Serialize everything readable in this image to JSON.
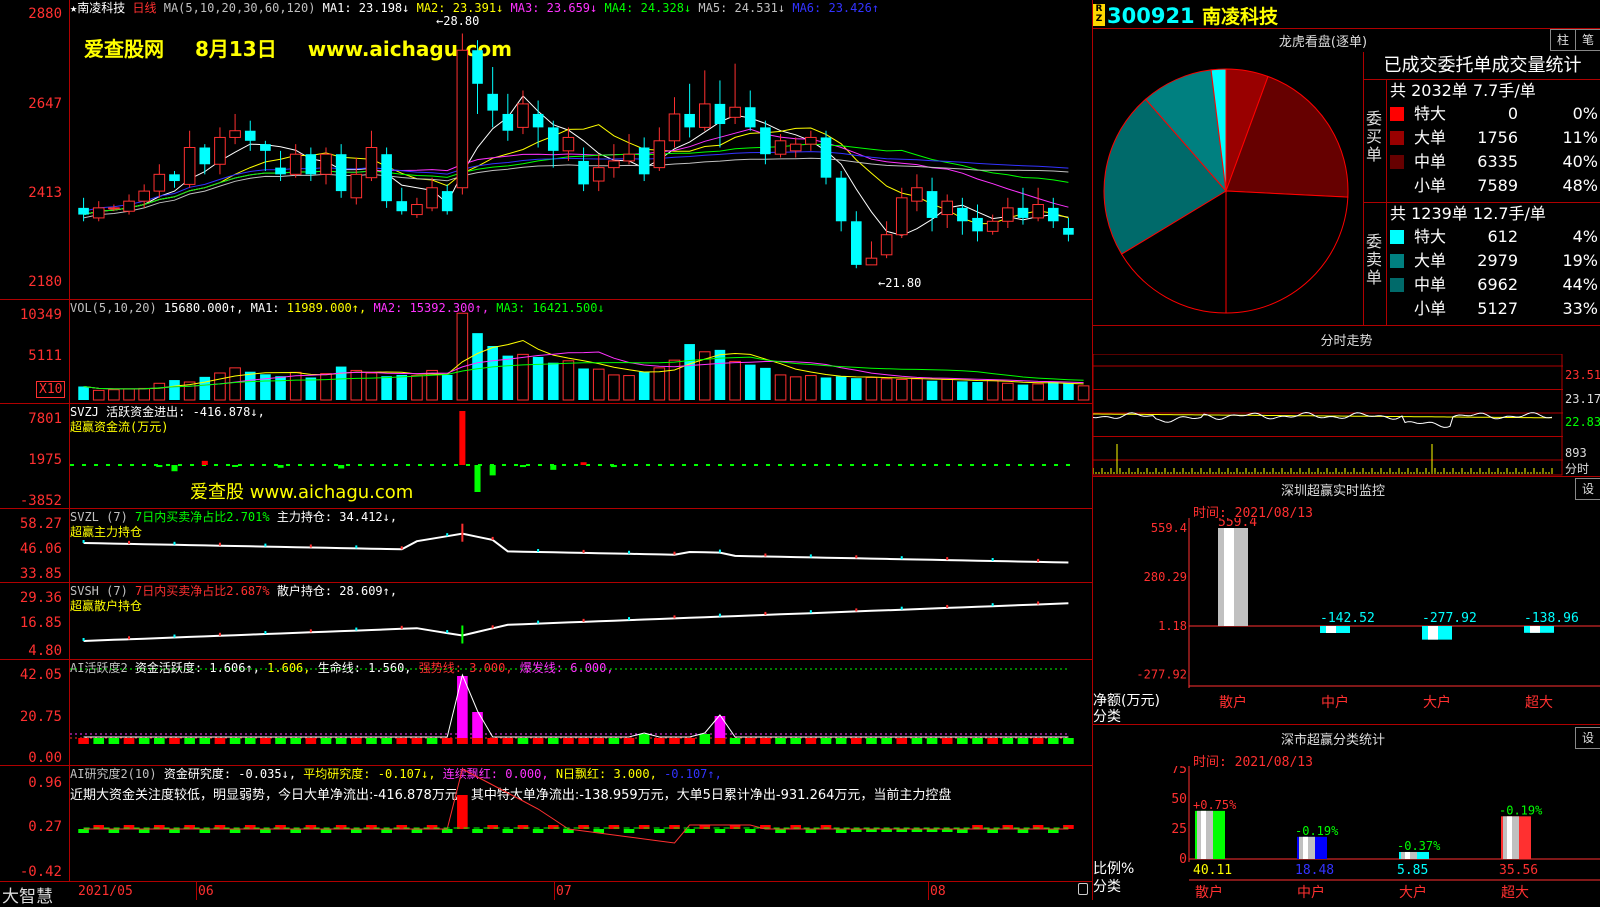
{
  "stock": {
    "code": "300921",
    "name": "南凌科技",
    "name_star": "★南凌科技",
    "period": "日线",
    "rz": "R\nZ"
  },
  "watermark": {
    "site_big": "爱查股网",
    "date": "8月13日",
    "url_big": "www.aichagu.com",
    "site_small": "爱查股",
    "url_small": "www.aichagu.com"
  },
  "main_chart": {
    "ma_params": "MA(5,10,20,30,60,120)",
    "ma_values": [
      {
        "label": "MA1:",
        "value": "23.198↓",
        "color": "#ffffff"
      },
      {
        "label": "MA2:",
        "value": "23.391↓",
        "color": "#ffff00"
      },
      {
        "label": "MA3:",
        "value": "23.659↓",
        "color": "#ff33ff"
      },
      {
        "label": "MA4:",
        "value": "24.328↓",
        "color": "#00ff00"
      },
      {
        "label": "MA5:",
        "value": "24.531↓",
        "color": "#c0c0c0"
      },
      {
        "label": "MA6:",
        "value": "23.426↑",
        "color": "#3333ff"
      }
    ],
    "y_ticks": [
      "2880",
      "2647",
      "2413",
      "2180"
    ],
    "high_label": "←28.80",
    "low_label": "←21.80",
    "candles": [
      [
        23.6,
        23.4,
        23.9,
        23.2
      ],
      [
        23.3,
        23.6,
        23.8,
        23.2
      ],
      [
        23.6,
        23.6,
        23.7,
        23.5
      ],
      [
        23.5,
        23.8,
        24.0,
        23.4
      ],
      [
        23.8,
        24.1,
        24.3,
        23.6
      ],
      [
        24.1,
        24.6,
        24.9,
        23.9
      ],
      [
        24.6,
        24.4,
        24.7,
        24.2
      ],
      [
        24.3,
        25.4,
        25.9,
        24.2
      ],
      [
        25.4,
        24.9,
        25.5,
        24.6
      ],
      [
        24.9,
        25.7,
        26.0,
        24.6
      ],
      [
        25.7,
        25.9,
        26.4,
        25.5
      ],
      [
        25.9,
        25.6,
        26.2,
        25.3
      ],
      [
        25.5,
        25.3,
        25.6,
        24.7
      ],
      [
        24.8,
        24.6,
        25.3,
        24.4
      ],
      [
        24.6,
        25.2,
        25.5,
        24.5
      ],
      [
        25.2,
        24.6,
        25.4,
        24.4
      ],
      [
        24.6,
        25.2,
        25.4,
        24.3
      ],
      [
        25.2,
        24.1,
        25.5,
        23.9
      ],
      [
        23.9,
        24.6,
        25.1,
        23.7
      ],
      [
        24.5,
        25.4,
        25.9,
        24.4
      ],
      [
        25.2,
        23.8,
        25.4,
        23.6
      ],
      [
        23.8,
        23.5,
        24.2,
        23.4
      ],
      [
        23.4,
        23.7,
        23.9,
        23.3
      ],
      [
        23.6,
        24.2,
        24.5,
        23.5
      ],
      [
        24.1,
        23.5,
        24.3,
        23.4
      ],
      [
        24.2,
        28.3,
        28.8,
        24.0
      ],
      [
        28.3,
        27.3,
        28.6,
        26.4
      ],
      [
        27.0,
        26.5,
        27.8,
        26.0
      ],
      [
        26.4,
        25.9,
        27.0,
        25.6
      ],
      [
        26.0,
        26.7,
        27.1,
        25.8
      ],
      [
        26.4,
        26.0,
        26.8,
        25.4
      ],
      [
        26.0,
        25.3,
        26.2,
        24.8
      ],
      [
        25.3,
        25.7,
        26.0,
        25.0
      ],
      [
        25.0,
        24.3,
        25.4,
        24.1
      ],
      [
        24.4,
        24.8,
        25.2,
        24.1
      ],
      [
        24.8,
        25.0,
        25.5,
        24.5
      ],
      [
        25.0,
        25.2,
        25.8,
        24.9
      ],
      [
        25.4,
        24.6,
        25.7,
        24.4
      ],
      [
        24.8,
        25.6,
        26.0,
        24.7
      ],
      [
        25.6,
        26.4,
        26.9,
        25.4
      ],
      [
        26.4,
        26.0,
        27.3,
        25.7
      ],
      [
        26.0,
        26.7,
        27.7,
        25.9
      ],
      [
        26.7,
        26.1,
        27.4,
        25.4
      ],
      [
        26.3,
        26.6,
        27.9,
        26.1
      ],
      [
        26.6,
        26.0,
        27.1,
        25.9
      ],
      [
        26.0,
        25.2,
        26.2,
        24.9
      ],
      [
        25.2,
        25.6,
        25.8,
        25.1
      ],
      [
        25.3,
        25.5,
        25.7,
        25.1
      ],
      [
        25.5,
        25.7,
        25.9,
        25.3
      ],
      [
        25.7,
        24.5,
        25.9,
        24.3
      ],
      [
        24.5,
        23.2,
        24.7,
        22.9
      ],
      [
        23.2,
        21.9,
        23.5,
        21.8
      ],
      [
        21.9,
        22.1,
        22.6,
        21.9
      ],
      [
        22.2,
        22.8,
        23.2,
        22.1
      ],
      [
        22.8,
        23.9,
        24.2,
        22.7
      ],
      [
        23.8,
        24.2,
        24.6,
        23.5
      ],
      [
        24.1,
        23.3,
        24.5,
        22.9
      ],
      [
        23.4,
        23.8,
        24.0,
        23.0
      ],
      [
        23.6,
        23.2,
        23.9,
        22.8
      ],
      [
        23.3,
        22.9,
        23.7,
        22.6
      ],
      [
        22.9,
        23.2,
        23.4,
        22.8
      ],
      [
        23.2,
        23.6,
        23.9,
        23.0
      ],
      [
        23.6,
        23.3,
        24.2,
        23.1
      ],
      [
        23.3,
        23.7,
        24.2,
        23.2
      ],
      [
        23.6,
        23.2,
        23.9,
        23.0
      ],
      [
        23.0,
        22.8,
        23.3,
        22.6
      ]
    ]
  },
  "volume": {
    "header": [
      {
        "text": "VOL(5,10,20)",
        "color": "#c0c0c0"
      },
      {
        "text": "15680.000↑,",
        "color": "#ffffff"
      },
      {
        "text": "MA1:",
        "color": "#ffffff"
      },
      {
        "text": "11989.000↑,",
        "color": "#ffff00"
      },
      {
        "text": "MA2:",
        "color": "#ff33ff"
      },
      {
        "text": "15392.300↑,",
        "color": "#ff33ff"
      },
      {
        "text": "MA3:",
        "color": "#00ff00"
      },
      {
        "text": "16421.500↓",
        "color": "#00ff00"
      }
    ],
    "y_ticks": [
      "10349",
      "5111"
    ],
    "unit": "X10",
    "values": [
      2.1,
      1.5,
      1.6,
      1.7,
      1.8,
      2.6,
      3.1,
      2.8,
      3.6,
      4.2,
      5.0,
      4.4,
      4.0,
      3.7,
      4.3,
      3.5,
      4.1,
      5.2,
      4.6,
      4.2,
      3.7,
      3.9,
      3.8,
      4.6,
      3.9,
      13.5,
      10.4,
      8.4,
      6.9,
      7.1,
      6.7,
      5.8,
      6.1,
      4.9,
      4.8,
      3.9,
      3.8,
      4.4,
      5.0,
      6.2,
      8.7,
      7.5,
      7.8,
      6.0,
      5.5,
      5.0,
      3.9,
      3.6,
      3.8,
      3.5,
      3.7,
      3.4,
      3.5,
      3.3,
      3.2,
      3.3,
      3.0,
      3.2,
      2.9,
      2.8,
      3.1,
      2.6,
      2.4,
      2.5,
      2.8,
      2.6,
      2.2
    ]
  },
  "svzj": {
    "header": [
      {
        "text": "SVZJ  活跃资金进出: -416.878↓,",
        "color": "#ffffff"
      }
    ],
    "subtitle": "超赢资金流(万元)",
    "y_ticks": [
      "7801",
      "1975",
      "-3852"
    ],
    "values": [
      0,
      0,
      0,
      0,
      0,
      -300,
      -900,
      0,
      600,
      0,
      -200,
      0,
      0,
      -400,
      0,
      0,
      0,
      -500,
      0,
      0,
      0,
      0,
      0,
      0,
      0,
      7800,
      -3900,
      -1500,
      0,
      -300,
      0,
      -700,
      0,
      400,
      0,
      -300,
      0,
      0,
      0,
      0,
      0,
      0,
      0,
      0,
      0,
      0,
      0,
      0,
      0,
      0,
      0,
      0,
      0,
      0,
      0,
      0,
      0,
      0,
      0,
      0,
      0,
      0,
      0,
      0,
      0,
      0,
      0
    ]
  },
  "svzl": {
    "header": [
      {
        "text": "SVZL (7)",
        "color": "#c0c0c0"
      },
      {
        "text": "7日内买卖净占比2.701%",
        "color": "#00ff00"
      },
      {
        "text": "主力持仓: 34.412↓,",
        "color": "#ffffff"
      }
    ],
    "subtitle": "超赢主力持仓",
    "y_ticks": [
      "58.27",
      "46.06",
      "33.85"
    ]
  },
  "svsh": {
    "header": [
      {
        "text": "SVSH (7)",
        "color": "#c0c0c0"
      },
      {
        "text": "7日内买卖净占比2.687%",
        "color": "#ff3030"
      },
      {
        "text": "散户持仓: 28.609↑,",
        "color": "#ffffff"
      }
    ],
    "subtitle": "超赢散户持仓",
    "y_ticks": [
      "29.36",
      "16.85",
      "4.80"
    ]
  },
  "ai_active": {
    "header": [
      {
        "text": "AI活跃度2",
        "color": "#c0c0c0"
      },
      {
        "text": "资金活跃度: 1.606↑,",
        "color": "#ffffff"
      },
      {
        "text": "1.606,",
        "color": "#ffff00"
      },
      {
        "text": "生命线: 1.560,",
        "color": "#ffffff"
      },
      {
        "text": "强势线: 3.000,",
        "color": "#ff3030"
      },
      {
        "text": "爆发线: 6.000,",
        "color": "#ff33ff"
      }
    ],
    "y_ticks": [
      "42.05",
      "20.75",
      "0.00"
    ]
  },
  "ai_research": {
    "header": [
      {
        "text": "AI研究度2(10)",
        "color": "#c0c0c0"
      },
      {
        "text": "资金研究度: -0.035↓,",
        "color": "#ffffff"
      },
      {
        "text": "平均研究度: -0.107↓,",
        "color": "#ffff00"
      },
      {
        "text": "连续飘红: 0.000,",
        "color": "#ff33ff"
      },
      {
        "text": "N日飘红: 3.000,",
        "color": "#ffff00"
      },
      {
        "text": "-0.107↑,",
        "color": "#3333ff"
      }
    ],
    "comment": "近期大资金关注度较低，明显弱势，今日大单净流出:-416.878万元，其中特大单净流出:-138.959万元，大单5日累计净出-931.264万元，当前主力控盘",
    "y_ticks": [
      "0.96",
      "0.27",
      "-0.42"
    ]
  },
  "x_axis": {
    "labels": [
      "2021/05",
      "06",
      "07",
      "08"
    ],
    "brand": "大智慧"
  },
  "lhb": {
    "title": "龙虎看盘(逐单)",
    "btn_bar": "柱",
    "btn_pen": "笔",
    "table_title": "已成交委托单成交量统计",
    "buy_label": "委买单",
    "sell_label": "委卖单",
    "buy_total": "共 2032单 7.7手/单",
    "sell_total": "共 1239单 12.7手/单",
    "buy_rows": [
      {
        "name": "特大",
        "count": "0",
        "pct": "0%",
        "color": "#ff0000"
      },
      {
        "name": "大单",
        "count": "1756",
        "pct": "11%",
        "color": "#990000"
      },
      {
        "name": "中单",
        "count": "6335",
        "pct": "40%",
        "color": "#660000"
      },
      {
        "name": "小单",
        "count": "7589",
        "pct": "48%",
        "color": "#000000"
      }
    ],
    "sell_rows": [
      {
        "name": "特大",
        "count": "612",
        "pct": "4%",
        "color": "#00ffff"
      },
      {
        "name": "大单",
        "count": "2979",
        "pct": "19%",
        "color": "#008080"
      },
      {
        "name": "中单",
        "count": "6962",
        "pct": "44%",
        "color": "#006a6a"
      },
      {
        "name": "小单",
        "count": "5127",
        "pct": "33%",
        "color": "#000000"
      }
    ]
  },
  "intraday": {
    "title": "分时走势",
    "prices": [
      "23.51",
      "23.17",
      "22.83"
    ],
    "vol": "893",
    "tag": "分时"
  },
  "sz_monitor": {
    "title": "深圳超赢实时监控",
    "btn": "设",
    "time": "时间: 2021/08/13",
    "y_ticks": [
      "559.4",
      "280.29",
      "1.18",
      "-277.92"
    ],
    "axis_label": "净额(万元)",
    "axis_label2": "分类",
    "bars": [
      {
        "name": "散户",
        "value": 559.4,
        "label": "559.4",
        "color": "#c0c0c0"
      },
      {
        "name": "中户",
        "value": -142.52,
        "label": "-142.52",
        "color": "#00ffff"
      },
      {
        "name": "大户",
        "value": -277.92,
        "label": "-277.92",
        "color": "#00ffff"
      },
      {
        "name": "超大",
        "value": -138.96,
        "label": "-138.96",
        "color": "#00ffff"
      }
    ]
  },
  "sz_stats": {
    "title": "深市超赢分类统计",
    "btn": "设",
    "time": "时间: 2021/08/13",
    "y_ticks": [
      "75",
      "50",
      "25",
      "0"
    ],
    "axis_label": "比例%",
    "axis_label2": "分类",
    "bars": [
      {
        "name": "散户",
        "ratio": 40.11,
        "label": "40.11",
        "change": "+0.75%",
        "change_color": "#ff3030",
        "color": "#00ff00"
      },
      {
        "name": "中户",
        "ratio": 18.48,
        "label": "18.48",
        "change": "-0.19%",
        "change_color": "#00ff00",
        "color": "#0000ff"
      },
      {
        "name": "大户",
        "ratio": 5.85,
        "label": "5.85",
        "change": "-0.37%",
        "change_color": "#00ff00",
        "color": "#00ffff"
      },
      {
        "name": "超大",
        "ratio": 35.56,
        "label": "35.56",
        "change": "-0.19%",
        "change_color": "#00ff00",
        "color": "#ff3030"
      }
    ]
  }
}
